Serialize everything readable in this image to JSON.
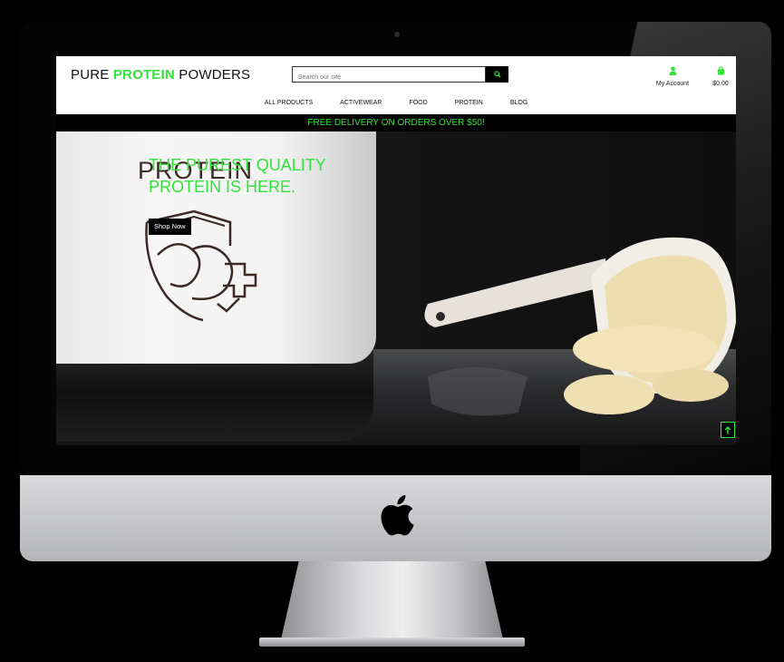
{
  "site": {
    "brand_prefix": "PURE ",
    "brand_accent": "PROTEIN",
    "brand_suffix": " POWDERS",
    "accent_color": "#33e33a"
  },
  "search": {
    "placeholder": "Search our site",
    "button_icon": "search-icon"
  },
  "account": {
    "label": "My Account",
    "icon": "user-icon"
  },
  "cart": {
    "total": "$0.00",
    "icon": "shopping-bag-icon"
  },
  "nav": {
    "items": [
      "ALL PRODUCTS",
      "ACTIVEWEAR",
      "FOOD",
      "PROTEIN",
      "BLOG"
    ]
  },
  "promo": {
    "text": "FREE DELIVERY ON ORDERS OVER $50!"
  },
  "hero": {
    "jar_word": "PROTEIN",
    "title": "THE PUREST QUALITY PROTEIN IS HERE.",
    "cta_label": "Shop Now"
  },
  "scroll_top": {
    "icon": "arrow-up-icon"
  }
}
